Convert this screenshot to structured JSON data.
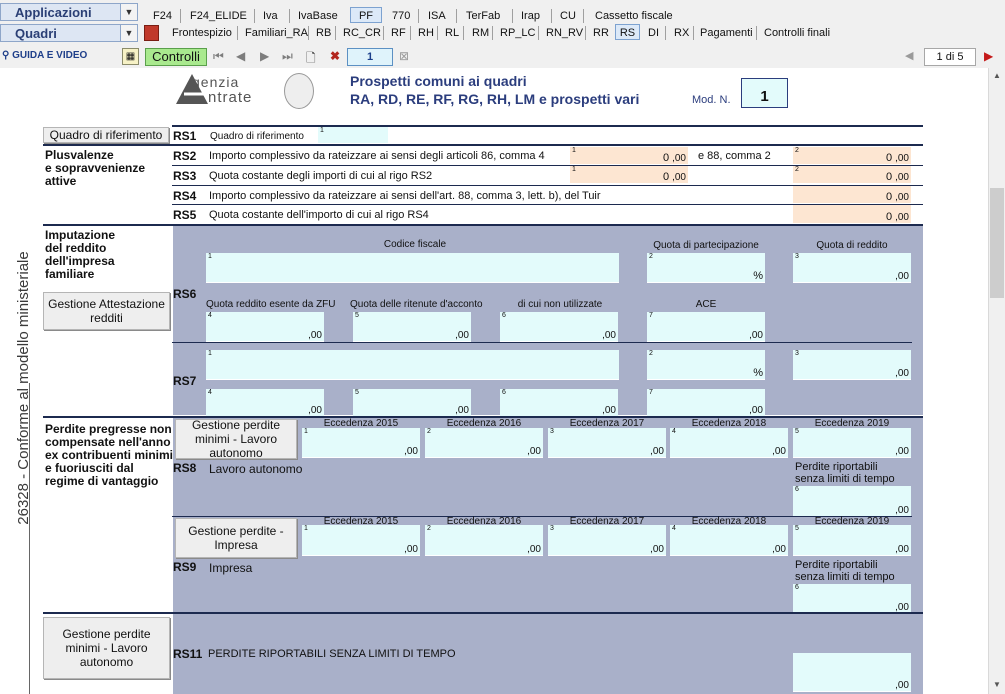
{
  "chrome": {
    "menu1": "Applicazioni",
    "menu2": "Quadri",
    "tabs_row1": [
      "F24",
      "F24_ELIDE",
      "Iva",
      "IvaBase",
      "PF",
      "770",
      "ISA",
      "TerFab",
      "Irap",
      "CU",
      "Cassetto fiscale"
    ],
    "tabs_row2": [
      "Frontespizio",
      "Familiari_RA",
      "RB",
      "RC_CR",
      "RF",
      "RH",
      "RL",
      "RM",
      "RP_LC",
      "RN_RV",
      "RR",
      "RS",
      "DI",
      "RX",
      "Pagamenti",
      "Controlli finali"
    ],
    "guida": "GUIDA E VIDEO",
    "controlli": "Controlli",
    "page_field": "1",
    "page_of": "1 di 5"
  },
  "header": {
    "logo_line1": "genzia",
    "logo_line2": "ntrate",
    "title1": "Prospetti comuni ai quadri",
    "title2": "RA, RD, RE, RF, RG, RH, LM e prospetti vari",
    "modn_label": "Mod. N.",
    "modn_value": "1"
  },
  "vertical_text": "26328 - Conforme al modello ministeriale",
  "rs1": {
    "button": "Quadro di riferimento",
    "code": "RS1",
    "label": "Quadro di riferimento",
    "n": "1"
  },
  "plus": {
    "title_lines": [
      "Plusvalenze",
      "e sopravvenienze",
      "attive"
    ],
    "rs2": {
      "code": "RS2",
      "text": "Importo complessivo da rateizzare ai sensi degli articoli 86, comma 4",
      "text2": "e 88, comma 2",
      "v1": "0",
      "v2": "0"
    },
    "rs3": {
      "code": "RS3",
      "text": "Quota costante degli importi di cui al rigo RS2",
      "v1": "0",
      "v2": "0"
    },
    "rs4": {
      "code": "RS4",
      "text": "Importo complessivo da rateizzare ai sensi dell'art. 88, comma 3, lett. b), del Tuir",
      "v": "0"
    },
    "rs5": {
      "code": "RS5",
      "text": "Quota costante dell'importo di cui al rigo RS4",
      "v": "0"
    }
  },
  "impr": {
    "title_lines": [
      "Imputazione",
      "del reddito",
      "dell'impresa",
      "familiare"
    ],
    "button": "Gestione Attestazione redditi",
    "h_cf": "Codice fiscale",
    "h_quota": "Quota di partecipazione",
    "h_reddito": "Quota di reddito",
    "h_zfu": "Quota reddito esente da ZFU",
    "h_ritenute": "Quota delle ritenute d'acconto",
    "h_nonutil": "di cui non utilizzate",
    "h_ace": "ACE",
    "rs6": "RS6",
    "rs7": "RS7",
    "pct": "%",
    "zero_dec": ",00"
  },
  "perdite": {
    "title_lines": [
      "Perdite pregresse non",
      "compensate nell'anno",
      "ex contribuenti minimi",
      "e fuoriusciti dal",
      "regime di vantaggio"
    ],
    "btn_min": "Gestione perdite minimi - Lavoro autonomo",
    "btn_imp": "Gestione perdite - Impresa",
    "years": [
      "Eccedenza 2015",
      "Eccedenza 2016",
      "Eccedenza 2017",
      "Eccedenza 2018",
      "Eccedenza 2019"
    ],
    "rs8": "RS8",
    "rs8_label": "Lavoro autonomo",
    "rs9": "RS9",
    "rs9_label": "Impresa",
    "senza_limiti": [
      "Perdite riportabili",
      "senza limiti di tempo"
    ]
  },
  "rs11": {
    "button": "Gestione perdite minimi - Lavoro autonomo",
    "code": "RS11",
    "label": "PERDITE RIPORTABILI SENZA LIMITI DI TEMPO"
  }
}
